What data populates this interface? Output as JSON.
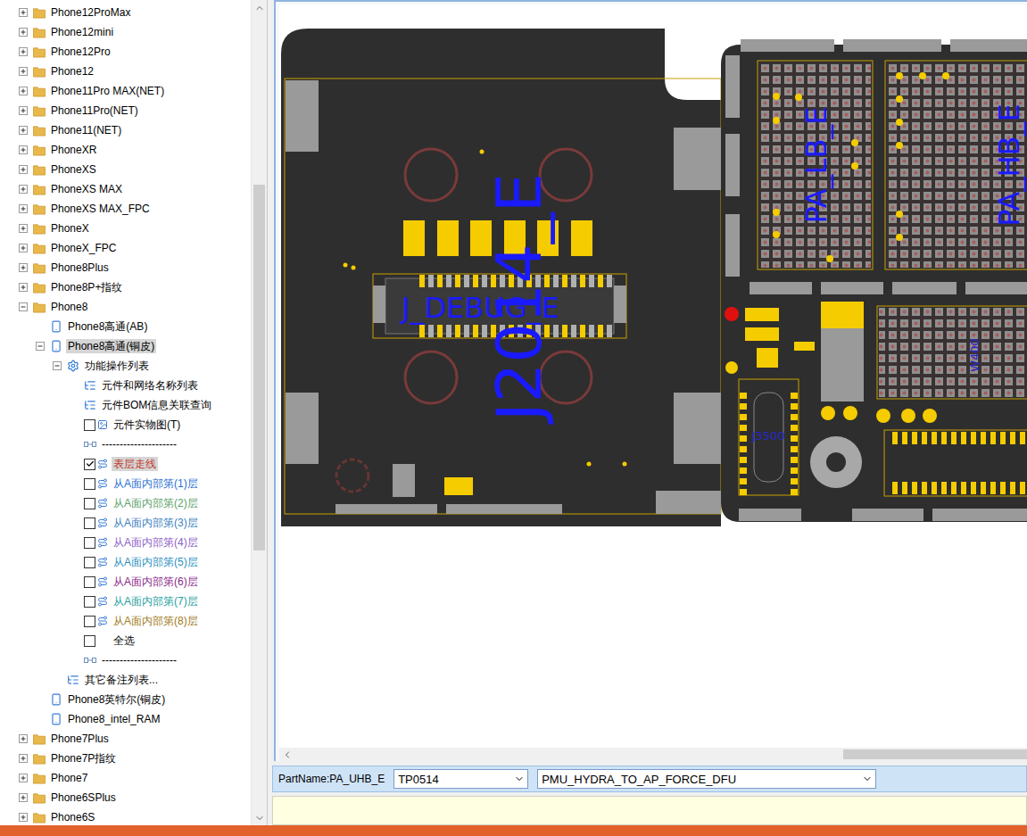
{
  "tree": {
    "items": [
      {
        "label": "Phone12ProMax",
        "kind": "folder",
        "depth": 0,
        "expandable": true,
        "expanded": false,
        "selected": false,
        "checked": false,
        "color": "#000000"
      },
      {
        "label": "Phone12mini",
        "kind": "folder",
        "depth": 0,
        "expandable": true,
        "expanded": false,
        "selected": false,
        "checked": false,
        "color": "#000000"
      },
      {
        "label": "Phone12Pro",
        "kind": "folder",
        "depth": 0,
        "expandable": true,
        "expanded": false,
        "selected": false,
        "checked": false,
        "color": "#000000"
      },
      {
        "label": "Phone12",
        "kind": "folder",
        "depth": 0,
        "expandable": true,
        "expanded": false,
        "selected": false,
        "checked": false,
        "color": "#000000"
      },
      {
        "label": "Phone11Pro MAX(NET)",
        "kind": "folder",
        "depth": 0,
        "expandable": true,
        "expanded": false,
        "selected": false,
        "checked": false,
        "color": "#000000"
      },
      {
        "label": "Phone11Pro(NET)",
        "kind": "folder",
        "depth": 0,
        "expandable": true,
        "expanded": false,
        "selected": false,
        "checked": false,
        "color": "#000000"
      },
      {
        "label": "Phone11(NET)",
        "kind": "folder",
        "depth": 0,
        "expandable": true,
        "expanded": false,
        "selected": false,
        "checked": false,
        "color": "#000000"
      },
      {
        "label": "PhoneXR",
        "kind": "folder",
        "depth": 0,
        "expandable": true,
        "expanded": false,
        "selected": false,
        "checked": false,
        "color": "#000000"
      },
      {
        "label": "PhoneXS",
        "kind": "folder",
        "depth": 0,
        "expandable": true,
        "expanded": false,
        "selected": false,
        "checked": false,
        "color": "#000000"
      },
      {
        "label": "PhoneXS MAX",
        "kind": "folder",
        "depth": 0,
        "expandable": true,
        "expanded": false,
        "selected": false,
        "checked": false,
        "color": "#000000"
      },
      {
        "label": "PhoneXS MAX_FPC",
        "kind": "folder",
        "depth": 0,
        "expandable": true,
        "expanded": false,
        "selected": false,
        "checked": false,
        "color": "#000000"
      },
      {
        "label": "PhoneX",
        "kind": "folder",
        "depth": 0,
        "expandable": true,
        "expanded": false,
        "selected": false,
        "checked": false,
        "color": "#000000"
      },
      {
        "label": "PhoneX_FPC",
        "kind": "folder",
        "depth": 0,
        "expandable": true,
        "expanded": false,
        "selected": false,
        "checked": false,
        "color": "#000000"
      },
      {
        "label": "Phone8Plus",
        "kind": "folder",
        "depth": 0,
        "expandable": true,
        "expanded": false,
        "selected": false,
        "checked": false,
        "color": "#000000"
      },
      {
        "label": "Phone8P+指纹",
        "kind": "folder",
        "depth": 0,
        "expandable": true,
        "expanded": false,
        "selected": false,
        "checked": false,
        "color": "#000000"
      },
      {
        "label": "Phone8",
        "kind": "folder",
        "depth": 0,
        "expandable": true,
        "expanded": true,
        "selected": false,
        "checked": false,
        "color": "#000000"
      },
      {
        "label": "Phone8高通(AB)",
        "kind": "device",
        "depth": 1,
        "expandable": false,
        "expanded": false,
        "selected": false,
        "checked": false,
        "color": "#000000"
      },
      {
        "label": "Phone8高通(铜皮)",
        "kind": "device",
        "depth": 1,
        "expandable": true,
        "expanded": true,
        "selected": true,
        "checked": false,
        "color": "#000000"
      },
      {
        "label": "功能操作列表",
        "kind": "gear",
        "depth": 2,
        "expandable": true,
        "expanded": true,
        "selected": false,
        "checked": false,
        "color": "#000000"
      },
      {
        "label": "元件和网络名称列表",
        "kind": "list",
        "depth": 3,
        "expandable": false,
        "expanded": false,
        "selected": false,
        "checked": false,
        "color": "#000000"
      },
      {
        "label": "元件BOM信息关联查询",
        "kind": "list",
        "depth": 3,
        "expandable": false,
        "expanded": false,
        "selected": false,
        "checked": false,
        "color": "#000000"
      },
      {
        "label": "元件实物图(T)",
        "kind": "image-check",
        "depth": 3,
        "expandable": false,
        "expanded": false,
        "selected": false,
        "checked": false,
        "color": "#000000"
      },
      {
        "label": "---------------------",
        "kind": "separator",
        "depth": 3,
        "expandable": false,
        "expanded": false,
        "selected": false,
        "checked": false,
        "color": "#000000"
      },
      {
        "label": "表层走线",
        "kind": "route-check",
        "depth": 3,
        "expandable": false,
        "expanded": false,
        "selected": true,
        "checked": true,
        "color": "#c0392b"
      },
      {
        "label": "从A面内部第(1)层",
        "kind": "route-check",
        "depth": 3,
        "expandable": false,
        "expanded": false,
        "selected": false,
        "checked": false,
        "color": "#1f6fd1"
      },
      {
        "label": "从A面内部第(2)层",
        "kind": "route-check",
        "depth": 3,
        "expandable": false,
        "expanded": false,
        "selected": false,
        "checked": false,
        "color": "#5aa16a"
      },
      {
        "label": "从A面内部第(3)层",
        "kind": "route-check",
        "depth": 3,
        "expandable": false,
        "expanded": false,
        "selected": false,
        "checked": false,
        "color": "#3a7ec0"
      },
      {
        "label": "从A面内部第(4)层",
        "kind": "route-check",
        "depth": 3,
        "expandable": false,
        "expanded": false,
        "selected": false,
        "checked": false,
        "color": "#8e5ec8"
      },
      {
        "label": "从A面内部第(5)层",
        "kind": "route-check",
        "depth": 3,
        "expandable": false,
        "expanded": false,
        "selected": false,
        "checked": false,
        "color": "#2a8fbf"
      },
      {
        "label": "从A面内部第(6)层",
        "kind": "route-check",
        "depth": 3,
        "expandable": false,
        "expanded": false,
        "selected": false,
        "checked": false,
        "color": "#8b1f8b"
      },
      {
        "label": "从A面内部第(7)层",
        "kind": "route-check",
        "depth": 3,
        "expandable": false,
        "expanded": false,
        "selected": false,
        "checked": false,
        "color": "#1fa0a0"
      },
      {
        "label": "从A面内部第(8)层",
        "kind": "route-check",
        "depth": 3,
        "expandable": false,
        "expanded": false,
        "selected": false,
        "checked": false,
        "color": "#a07a20"
      },
      {
        "label": "全选",
        "kind": "plain-check",
        "depth": 3,
        "expandable": false,
        "expanded": false,
        "selected": false,
        "checked": false,
        "color": "#000000"
      },
      {
        "label": "---------------------",
        "kind": "separator",
        "depth": 3,
        "expandable": false,
        "expanded": false,
        "selected": false,
        "checked": false,
        "color": "#000000"
      },
      {
        "label": "其它备注列表...",
        "kind": "list",
        "depth": 2,
        "expandable": false,
        "expanded": false,
        "selected": false,
        "checked": false,
        "color": "#000000"
      },
      {
        "label": "Phone8英特尔(铜皮)",
        "kind": "device",
        "depth": 1,
        "expandable": false,
        "expanded": false,
        "selected": false,
        "checked": false,
        "color": "#000000"
      },
      {
        "label": "Phone8_intel_RAM",
        "kind": "device",
        "depth": 1,
        "expandable": false,
        "expanded": false,
        "selected": false,
        "checked": false,
        "color": "#000000"
      },
      {
        "label": "Phone7Plus",
        "kind": "folder",
        "depth": 0,
        "expandable": true,
        "expanded": false,
        "selected": false,
        "checked": false,
        "color": "#000000"
      },
      {
        "label": "Phone7P指纹",
        "kind": "folder",
        "depth": 0,
        "expandable": true,
        "expanded": false,
        "selected": false,
        "checked": false,
        "color": "#000000"
      },
      {
        "label": "Phone7",
        "kind": "folder",
        "depth": 0,
        "expandable": true,
        "expanded": false,
        "selected": false,
        "checked": false,
        "color": "#000000"
      },
      {
        "label": "Phone6SPlus",
        "kind": "folder",
        "depth": 0,
        "expandable": true,
        "expanded": false,
        "selected": false,
        "checked": false,
        "color": "#000000"
      },
      {
        "label": "Phone6S",
        "kind": "folder",
        "depth": 0,
        "expandable": true,
        "expanded": false,
        "selected": false,
        "checked": false,
        "color": "#000000"
      }
    ]
  },
  "pcb": {
    "labels": {
      "connector": "J2014_E",
      "debug": "J_DEBUG_E",
      "pa_lb": "PA_LB_E",
      "pa_hb": "PA_HB_E",
      "j3500": "J3500",
      "w400": "W400"
    }
  },
  "part_bar": {
    "part_name": "PartName:PA_UHB_E",
    "pin": "TP0514",
    "net": "PMU_HYDRA_TO_AP_FORCE_DFU"
  }
}
